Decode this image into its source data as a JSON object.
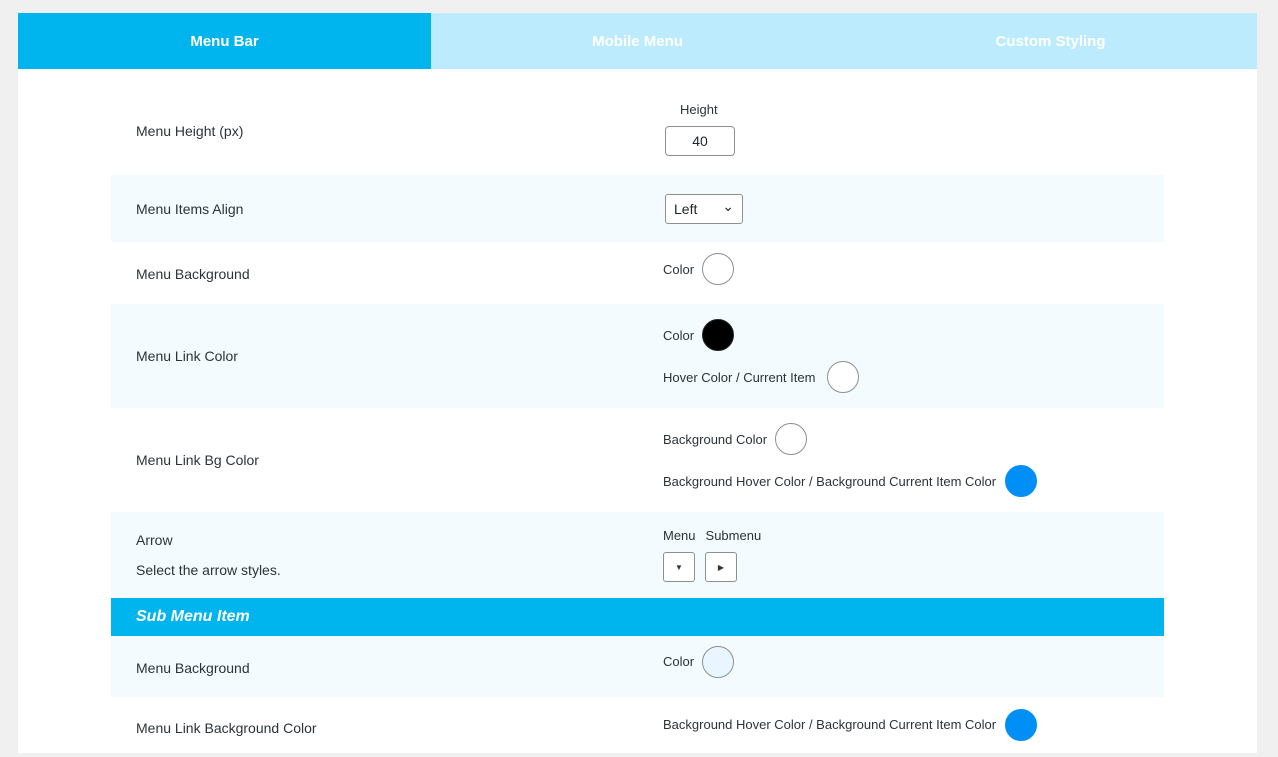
{
  "tabs": [
    {
      "label": "Menu Bar",
      "active": true
    },
    {
      "label": "Mobile Menu",
      "active": false
    },
    {
      "label": "Custom Styling",
      "active": false
    }
  ],
  "menu_bar": {
    "menu_height": {
      "label": "Menu Height (px)",
      "field_label": "Height",
      "value": "40"
    },
    "menu_items_align": {
      "label": "Menu Items Align",
      "selected": "Left"
    },
    "menu_background": {
      "label": "Menu Background",
      "color_label": "Color",
      "color": "#ffffff"
    },
    "menu_link_color": {
      "label": "Menu Link Color",
      "color_label": "Color",
      "color": "#000000",
      "hover_label": "Hover Color / Current Item",
      "hover_color": "#ffffff"
    },
    "menu_link_bg_color": {
      "label": "Menu Link Bg Color",
      "bg_label": "Background Color",
      "bg_color": "#ffffff",
      "hover_label": "Background Hover Color / Background Current Item Color",
      "hover_color": "#008ff7"
    },
    "arrow": {
      "label": "Arrow",
      "description": "Select the arrow styles.",
      "menu_label": "Menu",
      "submenu_label": "Submenu",
      "menu_glyph": "▼",
      "submenu_glyph": "▶"
    }
  },
  "sub_menu": {
    "header": "Sub Menu Item",
    "menu_background": {
      "label": "Menu Background",
      "color_label": "Color",
      "color": "#eaf6ff"
    },
    "menu_link_bg_color": {
      "label": "Menu Link Background Color",
      "hover_label": "Background Hover Color / Background Current Item Color",
      "hover_color": "#008ff7"
    }
  },
  "icons": {
    "select_chevron": "⌄"
  }
}
